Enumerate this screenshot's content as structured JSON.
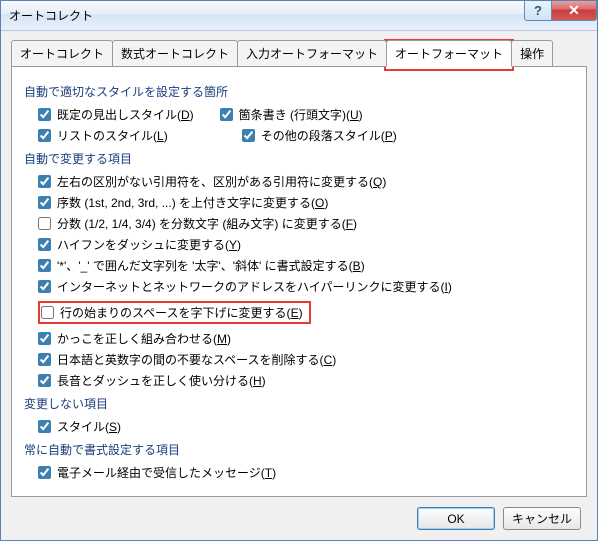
{
  "window": {
    "title": "オートコレクト"
  },
  "winbuttons": {
    "help": "?",
    "close": "✕"
  },
  "tabs": {
    "t0": "オートコレクト",
    "t1": "数式オートコレクト",
    "t2": "入力オートフォーマット",
    "t3": "オートフォーマット",
    "t4": "操作",
    "active_index": 3
  },
  "group1": {
    "title": "自動で適切なスタイルを設定する箇所",
    "items": {
      "a": {
        "label_pre": "既定の見出しスタイル(",
        "key": "D",
        "label_post": ")",
        "checked": true
      },
      "b": {
        "label_pre": "箇条書き (行頭文字)(",
        "key": "U",
        "label_post": ")",
        "checked": true
      },
      "c": {
        "label_pre": "リストのスタイル(",
        "key": "L",
        "label_post": ")",
        "checked": true
      },
      "d": {
        "label_pre": "その他の段落スタイル(",
        "key": "P",
        "label_post": ")",
        "checked": true
      }
    }
  },
  "group2": {
    "title": "自動で変更する項目",
    "items": {
      "a": {
        "label_pre": "左右の区別がない引用符を、区別がある引用符に変更する(",
        "key": "Q",
        "label_post": ")",
        "checked": true
      },
      "b": {
        "label_pre": "序数 (1st, 2nd, 3rd, ...) を上付き文字に変更する(",
        "key": "O",
        "label_post": ")",
        "checked": true
      },
      "c": {
        "label_pre": "分数 (1/2, 1/4, 3/4) を分数文字 (組み文字) に変更する(",
        "key": "F",
        "label_post": ")",
        "checked": false
      },
      "d": {
        "label_pre": "ハイフンをダッシュに変更する(",
        "key": "Y",
        "label_post": ")",
        "checked": true
      },
      "e": {
        "label_pre": "'*'、'_' で囲んだ文字列を '太字'、'斜体' に書式設定する(",
        "key": "B",
        "label_post": ")",
        "checked": true
      },
      "f": {
        "label_pre": "インターネットとネットワークのアドレスをハイパーリンクに変更する(",
        "key": "I",
        "label_post": ")",
        "checked": true
      },
      "g": {
        "label_pre": "行の始まりのスペースを字下げに変更する(",
        "key": "E",
        "label_post": ")",
        "checked": false,
        "highlight": true
      },
      "h": {
        "label_pre": "かっこを正しく組み合わせる(",
        "key": "M",
        "label_post": ")",
        "checked": true
      },
      "i": {
        "label_pre": "日本語と英数字の間の不要なスペースを削除する(",
        "key": "C",
        "label_post": ")",
        "checked": true
      },
      "j": {
        "label_pre": "長音とダッシュを正しく使い分ける(",
        "key": "H",
        "label_post": ")",
        "checked": true
      }
    }
  },
  "group3": {
    "title": "変更しない項目",
    "items": {
      "a": {
        "label_pre": "スタイル(",
        "key": "S",
        "label_post": ")",
        "checked": true
      }
    }
  },
  "group4": {
    "title": "常に自動で書式設定する項目",
    "items": {
      "a": {
        "label_pre": "電子メール経由で受信したメッセージ(",
        "key": "T",
        "label_post": ")",
        "checked": true
      }
    }
  },
  "buttons": {
    "ok": "OK",
    "cancel": "キャンセル"
  }
}
